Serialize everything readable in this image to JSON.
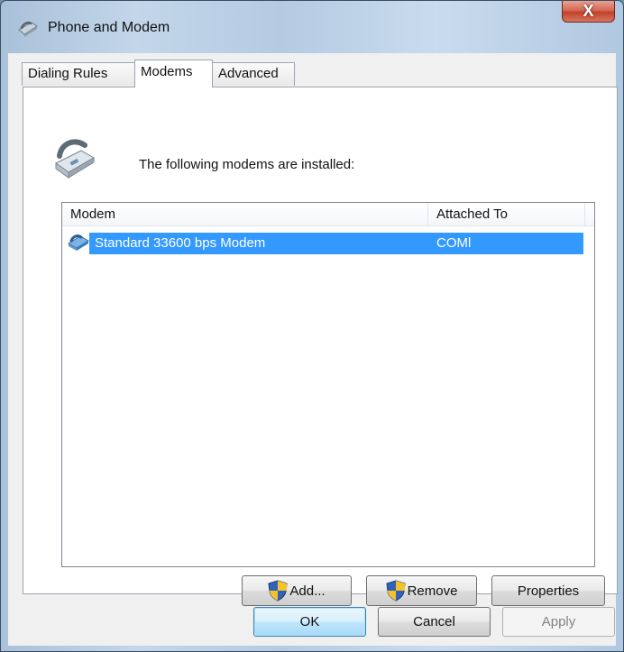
{
  "window": {
    "title": "Phone and Modem",
    "close_glyph": "X",
    "title_icon": "phone-modem-icon"
  },
  "tabs": [
    {
      "label": "Dialing Rules",
      "active": false
    },
    {
      "label": "Modems",
      "active": true
    },
    {
      "label": "Advanced",
      "active": false
    }
  ],
  "modems_tab": {
    "intro": "The following modems are installed:",
    "panel_icon": "telephone-icon",
    "list": {
      "columns": [
        "Modem",
        "Attached To"
      ],
      "rows": [
        {
          "modem": "Standard 33600 bps Modem",
          "attached_to": "COMl",
          "icon": "modem-icon",
          "selected": true
        }
      ]
    },
    "buttons": {
      "add": "Add...",
      "remove": "Remove",
      "properties": "Properties"
    }
  },
  "footer": {
    "ok": "OK",
    "cancel": "Cancel",
    "apply": "Apply"
  },
  "colors": {
    "selection": "#3399ff",
    "close_button": "#c2412a"
  }
}
